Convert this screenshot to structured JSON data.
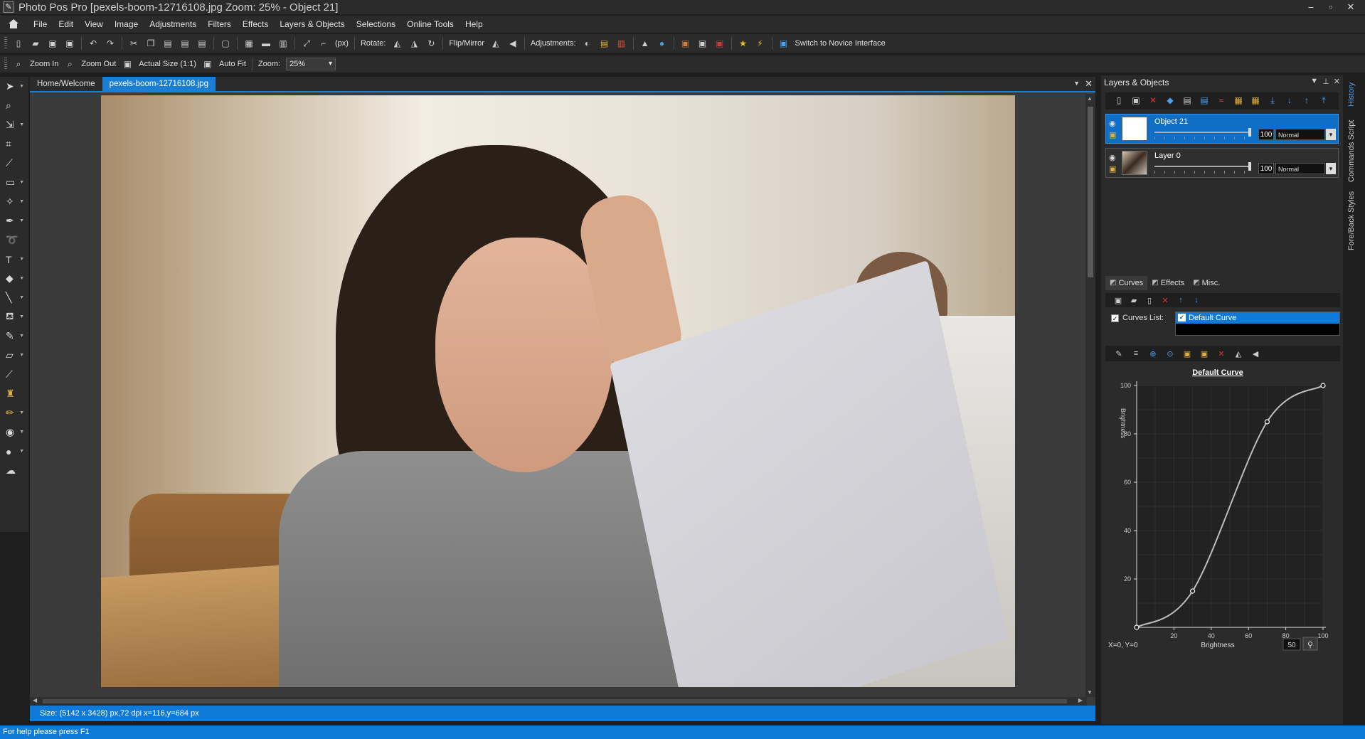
{
  "window": {
    "title": "Photo Pos Pro [pexels-boom-12716108.jpg Zoom: 25% - Object 21]",
    "controls": [
      "–",
      "▫",
      "✕"
    ]
  },
  "menu": [
    "File",
    "Edit",
    "View",
    "Image",
    "Adjustments",
    "Filters",
    "Effects",
    "Layers & Objects",
    "Selections",
    "Online Tools",
    "Help"
  ],
  "toolbar": {
    "units": "(px)",
    "rotate_label": "Rotate:",
    "flip_label": "Flip/Mirror",
    "adjustments_label": "Adjustments:",
    "novice_label": "Switch to Novice Interface"
  },
  "zoombar": {
    "zoom_in": "Zoom In",
    "zoom_out": "Zoom Out",
    "actual_size": "Actual Size (1:1)",
    "auto_fit": "Auto Fit",
    "zoom_label": "Zoom:",
    "zoom_value": "25%"
  },
  "doc_tabs": [
    "Home/Welcome",
    "pexels-boom-12716108.jpg"
  ],
  "doc_status": "Size: (5142 x 3428) px,72 dpi   x=116,y=684 px",
  "layers_panel": {
    "title": "Layers & Objects",
    "layers": [
      {
        "name": "Object 21",
        "opacity": "100",
        "blend": "Normal",
        "active": true
      },
      {
        "name": "Layer 0",
        "opacity": "100",
        "blend": "Normal",
        "active": false
      }
    ]
  },
  "subtabs": [
    "Curves",
    "Effects",
    "Misc."
  ],
  "curves": {
    "list_label": "Curves List:",
    "selected": "Default Curve",
    "chart_title": "Default Curve",
    "xlabel": "Brightness",
    "ylabel": "Brightness",
    "coords": "X=0, Y=0",
    "value_box": "50"
  },
  "chart_data": {
    "type": "line",
    "title": "Default Curve",
    "xlabel": "Brightness",
    "ylabel": "Brightness",
    "xlim": [
      0,
      100
    ],
    "ylim": [
      0,
      100
    ],
    "xticks": [
      20,
      40,
      60,
      80,
      100
    ],
    "yticks": [
      20,
      40,
      60,
      80,
      100
    ],
    "control_points": [
      {
        "x": 0,
        "y": 0
      },
      {
        "x": 30,
        "y": 15
      },
      {
        "x": 70,
        "y": 85
      },
      {
        "x": 100,
        "y": 100
      }
    ],
    "grid": true
  },
  "side_tabs": [
    "History",
    "Commands Script",
    "Fore/Back Styles"
  ],
  "status_bar": "For help please press F1"
}
